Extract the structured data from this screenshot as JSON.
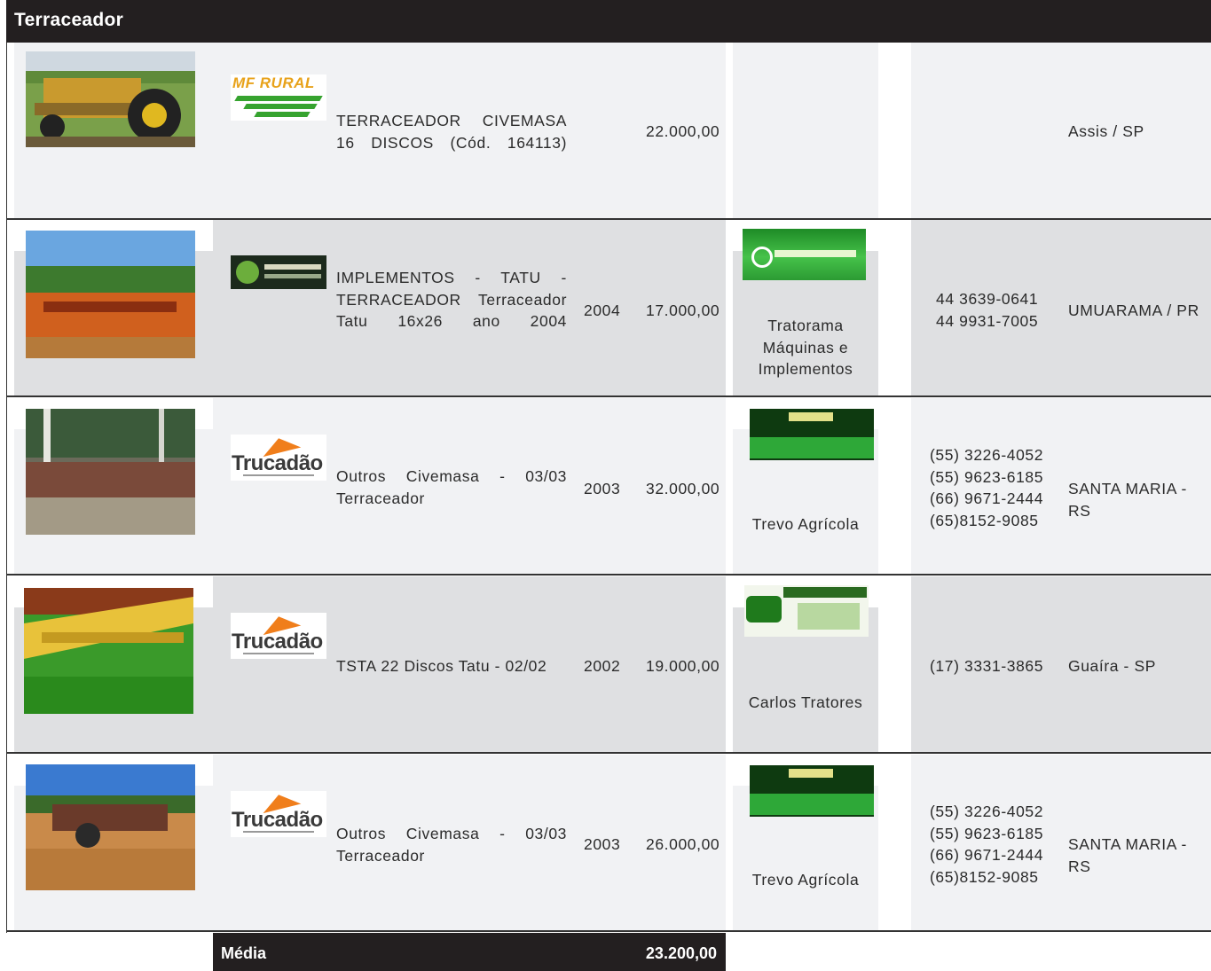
{
  "title": "Terraceador",
  "rows": [
    {
      "photo_icon": "tractor-yellow-photo",
      "logo_icon": "mf-rural-logo",
      "logo_text": "MF RURAL",
      "description": "TERRACEADOR CIVEMASA 16 DISCOS (Cód. 164113)",
      "year": "",
      "price": "22.000,00",
      "seller": "",
      "phones": "",
      "city": "Assis / SP"
    },
    {
      "photo_icon": "orange-implements-photo",
      "logo_icon": "dealer-logo-dark",
      "logo_text": "",
      "description": "IMPLEMENTOS - TATU - TERRACEADOR Terraceador Tatu 16x26 ano 2004",
      "year": "2004",
      "price": "17.000,00",
      "seller_logo_icon": "tratorama-logo",
      "seller": "Tratorama Máquinas e Implementos",
      "phones": "44 3639-0641\n44 9931-7005",
      "city": "UMUARAMA / PR"
    },
    {
      "photo_icon": "disc-harrow-photo",
      "logo_icon": "trucadao-logo",
      "logo_text": "Trucadão",
      "description": "Outros Civemasa - 03/03 Terraceador",
      "year": "2003",
      "price": "32.000,00",
      "seller_logo_icon": "trevo-agricola-logo",
      "seller": "Trevo Agrícola",
      "phones": "(55) 3226-4052\n(55) 9623-6185\n(66) 9671-2444\n(65)8152-9085",
      "city": "SANTA MARIA - RS"
    },
    {
      "photo_icon": "yellow-terracer-photo",
      "logo_icon": "trucadao-logo",
      "logo_text": "Trucadão",
      "description": "TSTA 22 Discos Tatu - 02/02",
      "year": "2002",
      "price": "19.000,00",
      "seller_logo_icon": "carlos-tratores-logo",
      "seller": "Carlos Tratores",
      "phones": "(17) 3331-3865",
      "city": "Guaíra - SP"
    },
    {
      "photo_icon": "field-terracer-photo",
      "logo_icon": "trucadao-logo",
      "logo_text": "Trucadão",
      "description": "Outros Civemasa - 03/03 Terraceador",
      "year": "2003",
      "price": "26.000,00",
      "seller_logo_icon": "trevo-agricola-logo",
      "seller": "Trevo Agrícola",
      "phones": "(55) 3226-4052\n(55) 9623-6185\n(66) 9671-2444\n(65)8152-9085",
      "city": "SANTA MARIA - RS"
    }
  ],
  "footer": {
    "label": "Média",
    "value": "23.200,00"
  },
  "colors": {
    "header_bg": "#231f20",
    "row_light": "#f1f2f4",
    "row_dark": "#dfe0e2",
    "trucadao_orange": "#f07e1b",
    "green": "#36a32f"
  }
}
